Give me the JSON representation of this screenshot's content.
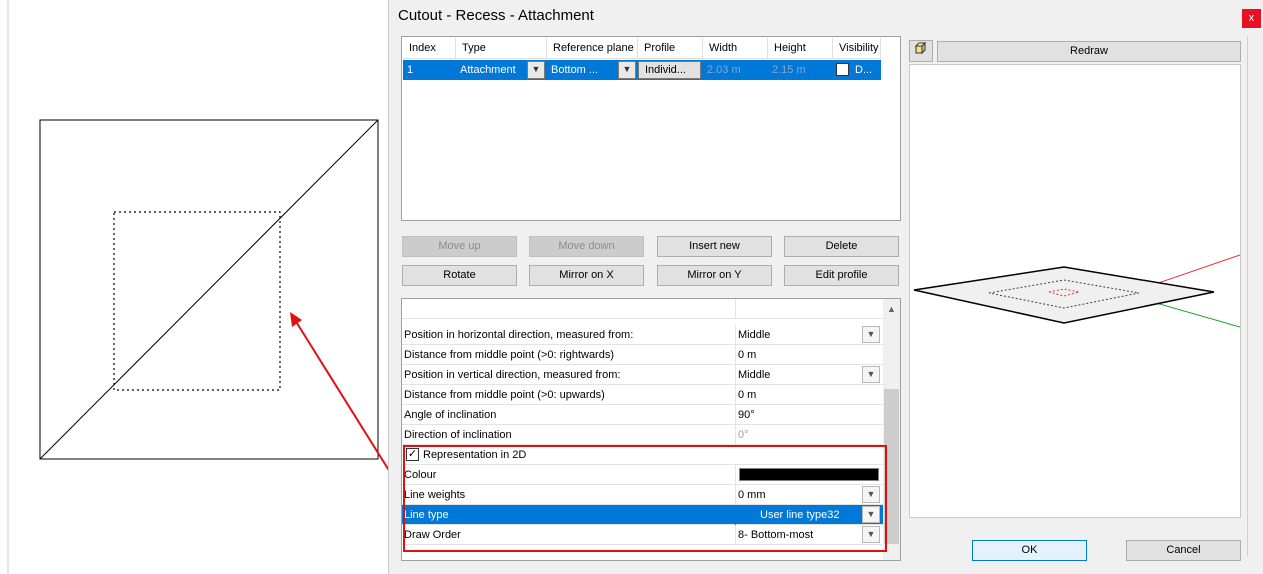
{
  "window": {
    "title": "Cutout - Recess - Attachment",
    "close_glyph": "x"
  },
  "table": {
    "headers": [
      "Index",
      "Type",
      "Reference plane",
      "Profile",
      "Width",
      "Height",
      "Visibility"
    ],
    "row": {
      "index": "1",
      "type": "Attachment",
      "reference_plane": "Bottom ...",
      "profile": "Individ...",
      "width": "2.03 m",
      "height": "2.15 m",
      "visibility": "D..."
    }
  },
  "buttons": {
    "move_up": "Move up",
    "move_down": "Move down",
    "insert_new": "Insert new",
    "delete": "Delete",
    "rotate": "Rotate",
    "mirror_x": "Mirror on X",
    "mirror_y": "Mirror on Y",
    "edit_profile": "Edit profile",
    "redraw": "Redraw",
    "ok": "OK",
    "cancel": "Cancel"
  },
  "properties": {
    "pos_h_label": "Position in horizontal direction, measured from:",
    "pos_h_value": "Middle",
    "dist_h_label": "Distance from middle point (>0: rightwards)",
    "dist_h_value": "0 m",
    "pos_v_label": "Position in vertical direction, measured from:",
    "pos_v_value": "Middle",
    "dist_v_label": "Distance from middle point (>0: upwards)",
    "dist_v_value": "0 m",
    "angle_label": "Angle of inclination",
    "angle_value": "90°",
    "direction_label": "Direction of inclination",
    "direction_value": "0°",
    "repr2d_label": "Representation in 2D",
    "colour_label": "Colour",
    "colour_value": "#000000",
    "line_weights_label": "Line weights",
    "line_weights_value": "0 mm",
    "line_type_label": "Line type",
    "line_type_value": "User line type32",
    "draw_order_label": "Draw Order",
    "draw_order_value": "8- Bottom-most"
  },
  "colors": {
    "selection": "#0078d7",
    "highlight": "#e01010"
  }
}
